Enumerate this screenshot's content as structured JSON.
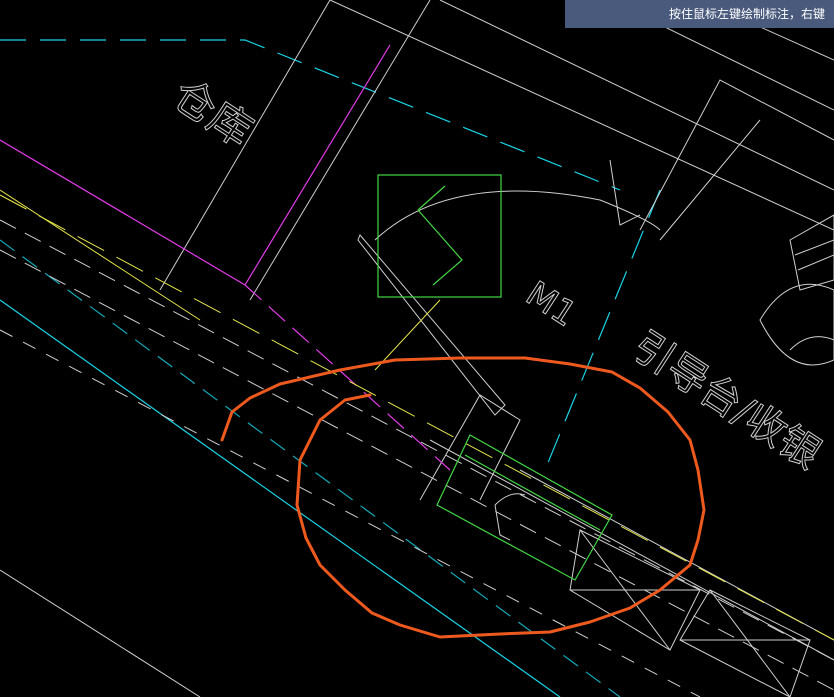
{
  "hint": {
    "text": "按住鼠标左键绘制标注，右键"
  },
  "drawing": {
    "labels": {
      "room_warehouse": "仓库",
      "door_tag": "M1",
      "room_reception": "引导台/收银"
    },
    "colors": {
      "background": "#000000",
      "walls": "#cfcfcf",
      "cyan_axis": "#19d3e6",
      "magenta_line": "#e23be8",
      "yellow_line": "#e6e64a",
      "green_select": "#42d742",
      "annotation_stroke": "#ee5a1e",
      "hint_bg": "#4a5a7c"
    }
  }
}
